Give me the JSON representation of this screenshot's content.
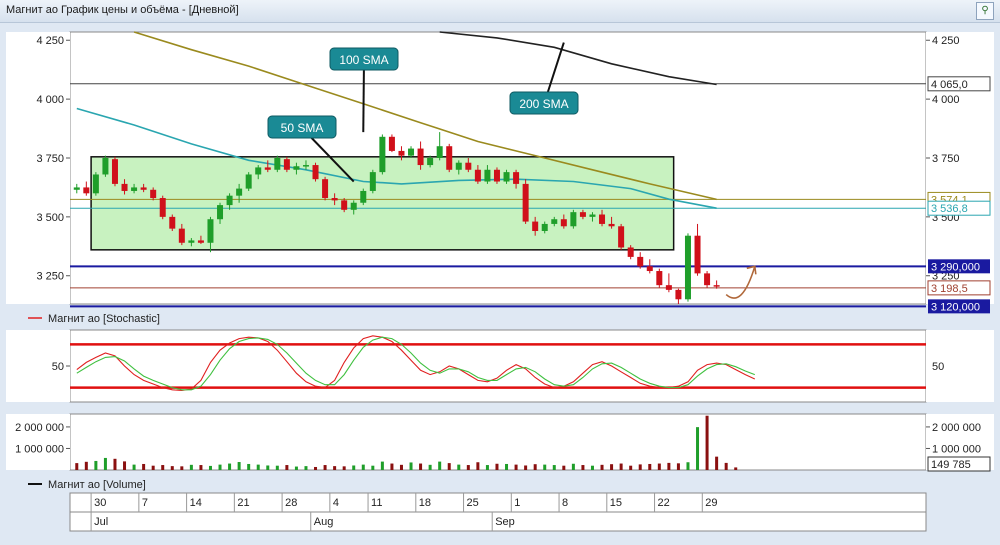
{
  "window": {
    "title": "Магнит ао График цены и объёма - [Дневной]"
  },
  "icons": {
    "pin": "pin-icon"
  },
  "colors": {
    "up": "#1f9e2a",
    "down": "#d0101a",
    "sma50": "#2aa6b0",
    "sma100": "#9a8a1e",
    "sma200": "#222222",
    "zone_fill": "#c8f2c0",
    "level_blue": "#1a1aa0",
    "stoch_k": "#e02020",
    "stoch_d": "#40c040"
  },
  "chart_data": [
    {
      "type": "candlestick",
      "name": "price",
      "y_ticks": [
        "4 250",
        "4 000",
        "3 750",
        "3 500",
        "3 250"
      ],
      "y_tick_values": [
        4250,
        4000,
        3750,
        3500,
        3250
      ],
      "ylim": [
        3130,
        4285
      ],
      "labels": {
        "sma50": "50 SMA",
        "sma100": "100 SMA",
        "sma200": "200 SMA"
      },
      "levels": [
        {
          "value": 4065.0,
          "label": "4 065,0",
          "color": "#444444",
          "style": "plain"
        },
        {
          "value": 3574.1,
          "label": "3 574,1",
          "color": "#9a8a1e",
          "style": "plain"
        },
        {
          "value": 3536.8,
          "label": "3 536,8",
          "color": "#2aa6b0",
          "style": "plain"
        },
        {
          "value": 3290,
          "label": "3 290,000",
          "color": "#1a1aa0",
          "style": "filled"
        },
        {
          "value": 3198.5,
          "label": "3 198,5",
          "color": "#a04030",
          "style": "plain"
        },
        {
          "value": 3120,
          "label": "3 120,000",
          "color": "#1a1aa0",
          "style": "filled"
        }
      ],
      "zone": {
        "y_top": 3755,
        "y_bottom": 3360,
        "x_start_index": 2,
        "x_end_index": 62
      },
      "candles": [
        [
          3615,
          3640,
          3600,
          3625
        ],
        [
          3625,
          3650,
          3590,
          3600
        ],
        [
          3600,
          3690,
          3590,
          3680
        ],
        [
          3680,
          3760,
          3670,
          3750
        ],
        [
          3745,
          3755,
          3630,
          3640
        ],
        [
          3640,
          3660,
          3595,
          3610
        ],
        [
          3610,
          3640,
          3600,
          3625
        ],
        [
          3625,
          3640,
          3605,
          3615
        ],
        [
          3615,
          3625,
          3570,
          3580
        ],
        [
          3580,
          3590,
          3490,
          3500
        ],
        [
          3500,
          3510,
          3440,
          3450
        ],
        [
          3450,
          3470,
          3380,
          3390
        ],
        [
          3390,
          3410,
          3375,
          3400
        ],
        [
          3400,
          3420,
          3385,
          3390
        ],
        [
          3390,
          3500,
          3350,
          3490
        ],
        [
          3490,
          3560,
          3470,
          3550
        ],
        [
          3550,
          3600,
          3530,
          3590
        ],
        [
          3590,
          3640,
          3560,
          3620
        ],
        [
          3620,
          3690,
          3610,
          3680
        ],
        [
          3680,
          3720,
          3660,
          3710
        ],
        [
          3710,
          3740,
          3690,
          3700
        ],
        [
          3700,
          3760,
          3690,
          3750
        ],
        [
          3745,
          3755,
          3690,
          3700
        ],
        [
          3700,
          3730,
          3680,
          3715
        ],
        [
          3715,
          3740,
          3700,
          3720
        ],
        [
          3720,
          3730,
          3650,
          3660
        ],
        [
          3660,
          3670,
          3570,
          3580
        ],
        [
          3580,
          3600,
          3550,
          3570
        ],
        [
          3570,
          3580,
          3520,
          3530
        ],
        [
          3530,
          3570,
          3510,
          3560
        ],
        [
          3560,
          3620,
          3550,
          3610
        ],
        [
          3610,
          3700,
          3600,
          3690
        ],
        [
          3690,
          3850,
          3680,
          3840
        ],
        [
          3840,
          3850,
          3775,
          3780
        ],
        [
          3780,
          3800,
          3740,
          3760
        ],
        [
          3760,
          3800,
          3750,
          3790
        ],
        [
          3790,
          3820,
          3700,
          3720
        ],
        [
          3720,
          3760,
          3710,
          3750
        ],
        [
          3750,
          3860,
          3740,
          3800
        ],
        [
          3800,
          3810,
          3690,
          3700
        ],
        [
          3700,
          3740,
          3680,
          3730
        ],
        [
          3730,
          3750,
          3690,
          3700
        ],
        [
          3700,
          3720,
          3640,
          3650
        ],
        [
          3650,
          3720,
          3640,
          3700
        ],
        [
          3700,
          3710,
          3640,
          3650
        ],
        [
          3650,
          3700,
          3640,
          3690
        ],
        [
          3690,
          3700,
          3620,
          3640
        ],
        [
          3640,
          3660,
          3470,
          3480
        ],
        [
          3480,
          3500,
          3420,
          3440
        ],
        [
          3440,
          3480,
          3430,
          3470
        ],
        [
          3470,
          3500,
          3460,
          3490
        ],
        [
          3490,
          3510,
          3450,
          3460
        ],
        [
          3460,
          3530,
          3450,
          3520
        ],
        [
          3520,
          3530,
          3490,
          3500
        ],
        [
          3500,
          3520,
          3480,
          3510
        ],
        [
          3510,
          3530,
          3460,
          3470
        ],
        [
          3470,
          3500,
          3450,
          3460
        ],
        [
          3460,
          3470,
          3360,
          3370
        ],
        [
          3370,
          3380,
          3320,
          3330
        ],
        [
          3330,
          3350,
          3280,
          3290
        ],
        [
          3290,
          3320,
          3260,
          3270
        ],
        [
          3270,
          3280,
          3200,
          3210
        ],
        [
          3210,
          3260,
          3180,
          3190
        ],
        [
          3190,
          3195,
          3130,
          3150
        ],
        [
          3150,
          3430,
          3140,
          3420
        ],
        [
          3420,
          3470,
          3250,
          3260
        ],
        [
          3260,
          3270,
          3200,
          3210
        ],
        [
          3210,
          3230,
          3195,
          3205
        ]
      ],
      "sma50": [
        [
          0,
          3960
        ],
        [
          6,
          3890
        ],
        [
          12,
          3810
        ],
        [
          18,
          3740
        ],
        [
          24,
          3700
        ],
        [
          30,
          3650
        ],
        [
          34,
          3640
        ],
        [
          40,
          3655
        ],
        [
          46,
          3660
        ],
        [
          52,
          3650
        ],
        [
          58,
          3620
        ],
        [
          62,
          3575
        ],
        [
          67,
          3537
        ]
      ],
      "sma100": [
        [
          6,
          4285
        ],
        [
          12,
          4210
        ],
        [
          18,
          4140
        ],
        [
          24,
          4060
        ],
        [
          30,
          3980
        ],
        [
          36,
          3900
        ],
        [
          42,
          3820
        ],
        [
          48,
          3760
        ],
        [
          54,
          3700
        ],
        [
          60,
          3640
        ],
        [
          67,
          3574
        ]
      ],
      "sma200": [
        [
          38,
          4285
        ],
        [
          44,
          4260
        ],
        [
          50,
          4220
        ],
        [
          56,
          4150
        ],
        [
          62,
          4095
        ],
        [
          67,
          4062
        ]
      ],
      "arrow": {
        "from_index": 68,
        "to_index": 71,
        "from_value": 3170,
        "to_value": 3290
      }
    },
    {
      "type": "line",
      "name": "Stochastic",
      "legend": "Магнит ао [Stochastic]",
      "y_ticks": [
        "50"
      ],
      "y_tick_values": [
        50
      ],
      "ylim": [
        0,
        100
      ],
      "upper_band": 80,
      "lower_band": 20,
      "series": [
        {
          "name": "%K",
          "values": [
            45,
            55,
            62,
            68,
            64,
            50,
            38,
            30,
            25,
            20,
            17,
            16,
            18,
            30,
            55,
            72,
            82,
            88,
            90,
            89,
            84,
            72,
            56,
            40,
            28,
            22,
            20,
            30,
            55,
            75,
            88,
            92,
            90,
            84,
            72,
            58,
            44,
            38,
            42,
            50,
            46,
            38,
            30,
            28,
            33,
            44,
            52,
            46,
            34,
            25,
            20,
            22,
            28,
            40,
            52,
            56,
            50,
            42,
            34,
            26,
            22,
            20,
            20,
            22,
            28,
            44,
            52,
            54,
            52,
            45,
            38,
            32
          ]
        },
        {
          "name": "%D",
          "values": [
            40,
            48,
            56,
            62,
            63,
            57,
            46,
            36,
            30,
            25,
            20,
            17,
            17,
            22,
            38,
            58,
            74,
            84,
            88,
            89,
            87,
            80,
            68,
            54,
            40,
            30,
            24,
            24,
            38,
            58,
            76,
            86,
            90,
            88,
            80,
            68,
            54,
            44,
            40,
            46,
            46,
            42,
            34,
            30,
            30,
            38,
            46,
            48,
            42,
            32,
            24,
            22,
            24,
            34,
            46,
            53,
            54,
            48,
            40,
            32,
            26,
            22,
            20,
            20,
            24,
            36,
            46,
            52,
            53,
            49,
            43,
            38
          ]
        }
      ]
    },
    {
      "type": "bar",
      "name": "Volume",
      "legend": "Магнит ао [Volume]",
      "y_ticks": [
        "2 000 000",
        "1 000 000"
      ],
      "y_tick_values": [
        2000000,
        1000000
      ],
      "ylim": [
        0,
        2600000
      ],
      "last_value_label": "149 785",
      "values": [
        320000,
        380000,
        420000,
        560000,
        520000,
        400000,
        250000,
        280000,
        200000,
        230000,
        180000,
        170000,
        240000,
        230000,
        190000,
        250000,
        300000,
        370000,
        280000,
        250000,
        210000,
        200000,
        230000,
        160000,
        180000,
        140000,
        230000,
        180000,
        170000,
        210000,
        250000,
        200000,
        390000,
        300000,
        240000,
        350000,
        300000,
        240000,
        390000,
        320000,
        250000,
        230000,
        360000,
        230000,
        290000,
        280000,
        250000,
        210000,
        270000,
        250000,
        230000,
        200000,
        290000,
        230000,
        200000,
        240000,
        270000,
        300000,
        200000,
        260000,
        280000,
        300000,
        330000,
        310000,
        360000,
        1990000,
        2520000,
        620000,
        330000,
        120000
      ],
      "directions": [
        "d",
        "d",
        "u",
        "u",
        "d",
        "d",
        "u",
        "d",
        "d",
        "d",
        "d",
        "d",
        "u",
        "d",
        "u",
        "u",
        "u",
        "u",
        "u",
        "u",
        "u",
        "u",
        "d",
        "u",
        "u",
        "d",
        "d",
        "d",
        "d",
        "u",
        "u",
        "u",
        "u",
        "d",
        "d",
        "u",
        "d",
        "u",
        "u",
        "d",
        "u",
        "d",
        "d",
        "u",
        "d",
        "u",
        "d",
        "d",
        "d",
        "u",
        "u",
        "d",
        "u",
        "d",
        "u",
        "d",
        "d",
        "d",
        "d",
        "d",
        "d",
        "d",
        "d",
        "d",
        "u",
        "u",
        "d",
        "d",
        "d",
        "d"
      ]
    }
  ],
  "x_axis": {
    "day_labels": [
      {
        "text": "30",
        "index": 2
      },
      {
        "text": "7",
        "index": 7
      },
      {
        "text": "14",
        "index": 12
      },
      {
        "text": "21",
        "index": 17
      },
      {
        "text": "28",
        "index": 22
      },
      {
        "text": "4",
        "index": 27
      },
      {
        "text": "11",
        "index": 31
      },
      {
        "text": "18",
        "index": 36
      },
      {
        "text": "25",
        "index": 41
      },
      {
        "text": "1",
        "index": 46
      },
      {
        "text": "8",
        "index": 51
      },
      {
        "text": "15",
        "index": 56
      },
      {
        "text": "22",
        "index": 61
      },
      {
        "text": "29",
        "index": 66
      }
    ],
    "month_labels": [
      {
        "text": "Jul",
        "index": 2
      },
      {
        "text": "Aug",
        "index": 25
      },
      {
        "text": "Sep",
        "index": 44
      }
    ]
  }
}
